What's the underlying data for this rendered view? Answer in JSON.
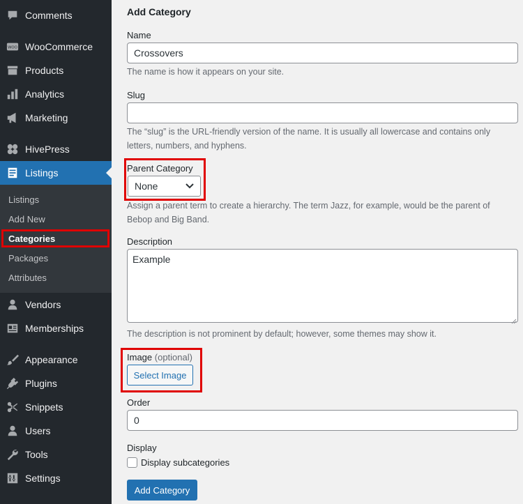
{
  "sidebar": {
    "items": [
      {
        "label": "Comments",
        "icon": "comment-icon"
      },
      {
        "label": "WooCommerce",
        "icon": "woo-icon"
      },
      {
        "label": "Products",
        "icon": "box-icon"
      },
      {
        "label": "Analytics",
        "icon": "bar-chart-icon"
      },
      {
        "label": "Marketing",
        "icon": "megaphone-icon"
      },
      {
        "label": "HivePress",
        "icon": "hive-icon"
      },
      {
        "label": "Listings",
        "icon": "listing-icon"
      },
      {
        "label": "Vendors",
        "icon": "person-icon"
      },
      {
        "label": "Memberships",
        "icon": "id-card-icon"
      },
      {
        "label": "Appearance",
        "icon": "paintbrush-icon"
      },
      {
        "label": "Plugins",
        "icon": "plug-icon"
      },
      {
        "label": "Snippets",
        "icon": "scissors-icon"
      },
      {
        "label": "Users",
        "icon": "user-icon"
      },
      {
        "label": "Tools",
        "icon": "wrench-icon"
      },
      {
        "label": "Settings",
        "icon": "settings-icon"
      }
    ],
    "submenu": [
      "Listings",
      "Add New",
      "Categories",
      "Packages",
      "Attributes"
    ]
  },
  "form": {
    "heading": "Add Category",
    "name_label": "Name",
    "name_value": "Crossovers",
    "name_help": "The name is how it appears on your site.",
    "slug_label": "Slug",
    "slug_value": "",
    "slug_help": "The “slug” is the URL-friendly version of the name. It is usually all lowercase and contains only letters, numbers, and hyphens.",
    "parent_label": "Parent Category",
    "parent_value": "None",
    "parent_help": "Assign a parent term to create a hierarchy. The term Jazz, for example, would be the parent of Bebop and Big Band.",
    "description_label": "Description",
    "description_value": "Example",
    "description_help": "The description is not prominent by default; however, some themes may show it.",
    "image_label": "Image",
    "image_optional": "(optional)",
    "select_image": "Select Image",
    "order_label": "Order",
    "order_value": "0",
    "display_label": "Display",
    "display_checkbox": "Display subcategories",
    "submit": "Add Category"
  },
  "colors": {
    "accent": "#2271b1",
    "highlight": "#e00000",
    "sidebar": "#23282d"
  }
}
